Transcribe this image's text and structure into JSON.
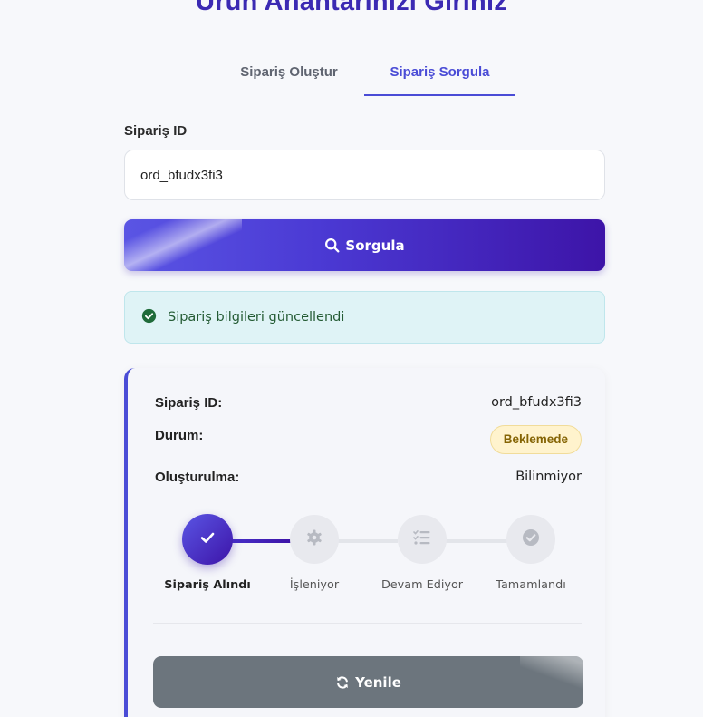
{
  "header": {
    "title": "Ürün Anahtarınızı Giriniz"
  },
  "tabs": [
    {
      "label": "Sipariş Oluştur",
      "active": false
    },
    {
      "label": "Sipariş Sorgula",
      "active": true
    }
  ],
  "form": {
    "order_id_label": "Sipariş ID",
    "order_id_value": "ord_bfudx3fi3",
    "query_button_label": "Sorgula",
    "query_button_icon": "search-icon"
  },
  "alert": {
    "icon": "check-circle-icon",
    "message": "Sipariş bilgileri güncellendi"
  },
  "details": {
    "order_id_label": "Sipariş ID:",
    "order_id_value": "ord_bfudx3fi3",
    "status_label": "Durum:",
    "status_value": "Beklemede",
    "created_label": "Oluşturulma:",
    "created_value": "Bilinmiyor"
  },
  "steps": [
    {
      "label": "Sipariş Alındı",
      "icon": "check-icon",
      "active": true
    },
    {
      "label": "İşleniyor",
      "icon": "gear-icon",
      "active": false
    },
    {
      "label": "Devam Ediyor",
      "icon": "list-check-icon",
      "active": false
    },
    {
      "label": "Tamamlandı",
      "icon": "check-circle-icon",
      "active": false
    }
  ],
  "refresh": {
    "label": "Yenile",
    "icon": "refresh-icon"
  },
  "colors": {
    "accent": "#4a4cd6",
    "title": "#3b2ab3",
    "badge_bg": "#fff3cd",
    "badge_text": "#856404",
    "alert_bg": "#dff3f6",
    "refresh_bg": "#6c757d"
  }
}
